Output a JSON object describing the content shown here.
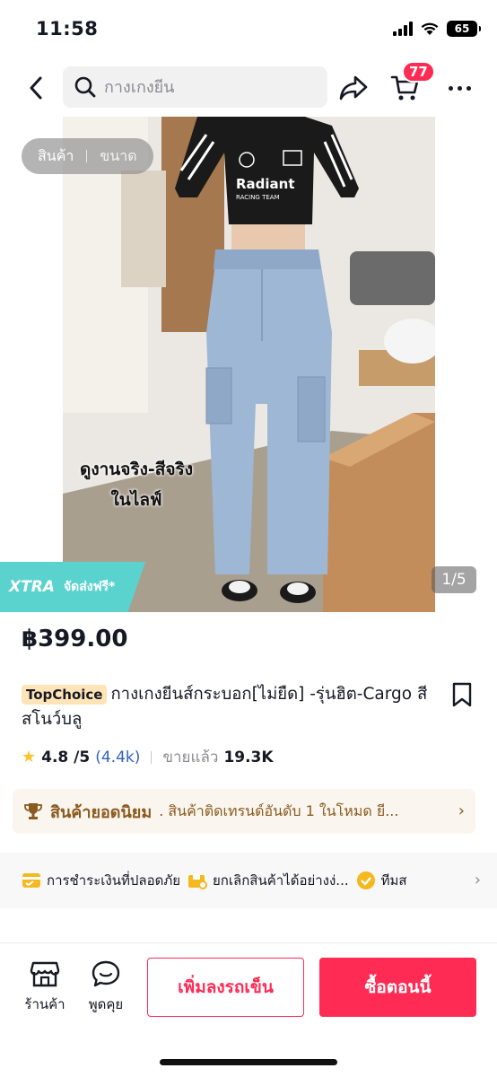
{
  "status": {
    "time": "11:58",
    "battery": "65"
  },
  "nav": {
    "search_placeholder": "กางเกงยีน",
    "cart_count": "77"
  },
  "gallery": {
    "tabs": [
      "สินค้า",
      "ขนาด"
    ],
    "overlay_line1": "ดูงานจริง-สีจริง",
    "overlay_line2": "ในไลฟ์",
    "shirt_text": "Radiant",
    "shirt_subtext": "RACING TEAM",
    "pager": "1/5"
  },
  "promo": {
    "xtra_logo": "XTRA",
    "xtra_text": "จัดส่งฟรี*"
  },
  "product": {
    "price": "฿399.00",
    "badge": "TopChoice",
    "title": "กางเกงยีนส์กระบอก[ไม่ยืด] -รุ่นฮิต-Cargo สี สโนว์บลู",
    "rating": "4.8 /5",
    "rating_count": "(4.4k)",
    "sold_label": "ขายแล้ว",
    "sold": "19.3K"
  },
  "popular": {
    "label": "สินค้ายอดนิยม",
    "desc": ". สินค้าติดเทรนด์อันดับ 1 ในโหมด ยี..."
  },
  "guarantees": [
    {
      "icon": "card-check-icon",
      "label": "การชำระเงินที่ปลอดภัย"
    },
    {
      "icon": "return-box-icon",
      "label": "ยกเลิกสินค้าได้อย่างง่..."
    },
    {
      "icon": "check-badge-icon",
      "label": "ทีมส"
    }
  ],
  "bottom": {
    "shop_label": "ร้านค้า",
    "chat_label": "พูดคุย",
    "add_to_cart": "เพิ่มลงรถเข็น",
    "buy_now": "ซื้อตอนนี้"
  }
}
